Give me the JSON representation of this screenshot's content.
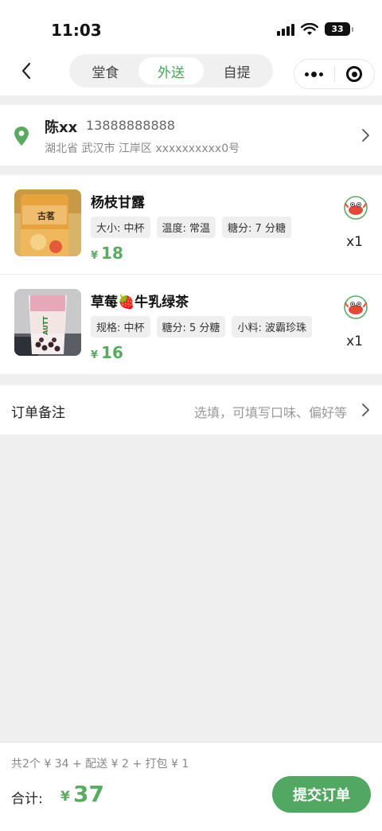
{
  "status": {
    "time": "11:03",
    "battery": "33"
  },
  "nav": {
    "tabs": [
      {
        "label": "堂食",
        "active": false
      },
      {
        "label": "外送",
        "active": true
      },
      {
        "label": "自提",
        "active": false
      }
    ]
  },
  "address": {
    "name": "陈xx",
    "phone": "13888888888",
    "detail": "湖北省 武汉市 江岸区 xxxxxxxxxx0号"
  },
  "items": [
    {
      "name": "杨枝甘露",
      "tags": [
        "大小: 中杯",
        "温度: 常温",
        "糖分: 7 分糖"
      ],
      "currency": "¥",
      "price": "18",
      "quantity": "x1",
      "image_text": "古茗"
    },
    {
      "name": "草莓🍓牛乳绿茶",
      "tags": [
        "规格: 中杯",
        "糖分: 5 分糖",
        "小料: 波霸珍珠"
      ],
      "currency": "¥",
      "price": "16",
      "quantity": "x1",
      "image_text": "AUTT"
    }
  ],
  "notes": {
    "label": "订单备注",
    "placeholder": "选填，可填写口味、偏好等"
  },
  "footer": {
    "summary": "共2个 ¥ 34 + 配送 ¥ 2 + 打包 ¥ 1",
    "total_label": "合计:",
    "currency": "¥",
    "total": "37",
    "submit_label": "提交订单"
  },
  "colors": {
    "accent": "#52a762",
    "price": "#5aab62",
    "background": "#efefef"
  }
}
